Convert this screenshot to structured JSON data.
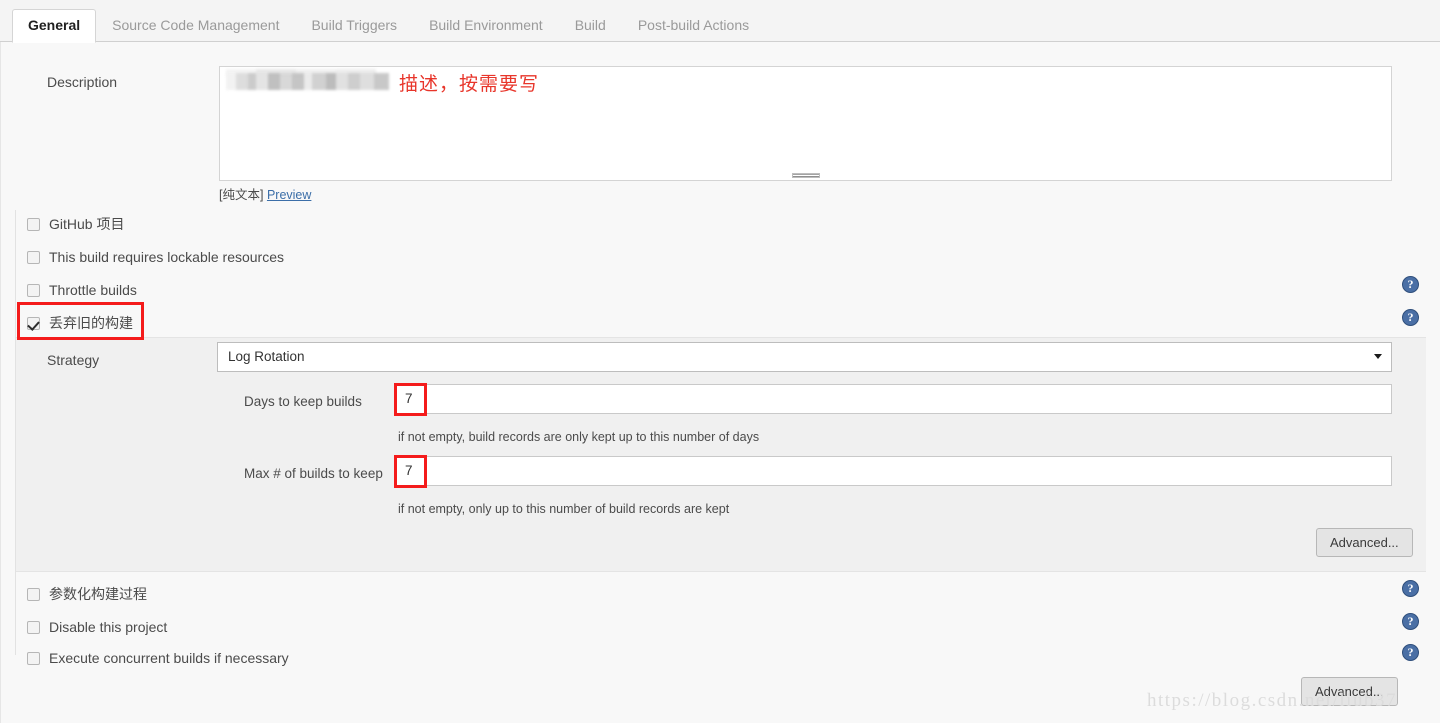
{
  "tabs": [
    {
      "label": "General",
      "active": true
    },
    {
      "label": "Source Code Management",
      "active": false
    },
    {
      "label": "Build Triggers",
      "active": false
    },
    {
      "label": "Build Environment",
      "active": false
    },
    {
      "label": "Build",
      "active": false
    },
    {
      "label": "Post-build Actions",
      "active": false
    }
  ],
  "description": {
    "label": "Description",
    "value": "",
    "redacted": true,
    "annotation": "描述，按需要写",
    "footer_markup": "[纯文本]",
    "preview_link": "Preview"
  },
  "checkboxes_top": [
    {
      "label": "GitHub 项目",
      "checked": false,
      "help": false
    },
    {
      "label": "This build requires lockable resources",
      "checked": false,
      "help": false
    },
    {
      "label": "Throttle builds",
      "checked": false,
      "help": true
    },
    {
      "label": "丢弃旧的构建",
      "checked": true,
      "help": true,
      "highlighted": true
    }
  ],
  "strategy": {
    "label": "Strategy",
    "selected": "Log Rotation",
    "options": [
      "Log Rotation"
    ],
    "caret_icon": "chevron-down-icon",
    "days_to_keep": {
      "label": "Days to keep builds",
      "value": "7",
      "hint": "if not empty, build records are only kept up to this number of days",
      "highlighted": true
    },
    "max_builds_to_keep": {
      "label": "Max # of builds to keep",
      "value": "7",
      "hint": "if not empty, only up to this number of build records are kept",
      "highlighted": true
    },
    "advanced_button": "Advanced..."
  },
  "checkboxes_bottom": [
    {
      "label": "参数化构建过程",
      "checked": false,
      "help": true
    },
    {
      "label": "Disable this project",
      "checked": false,
      "help": true
    },
    {
      "label": "Execute concurrent builds if necessary",
      "checked": false,
      "help": true
    }
  ],
  "footer": {
    "advanced_button": "Advanced..."
  },
  "watermark": "https://blog.csdn.net/liub37",
  "colors": {
    "accent_red": "#f41b1b",
    "help_blue": "#4a6fa5",
    "link_blue": "#3b6ea8",
    "annotation_red": "#e8352a"
  },
  "icons": {
    "help": "?"
  }
}
